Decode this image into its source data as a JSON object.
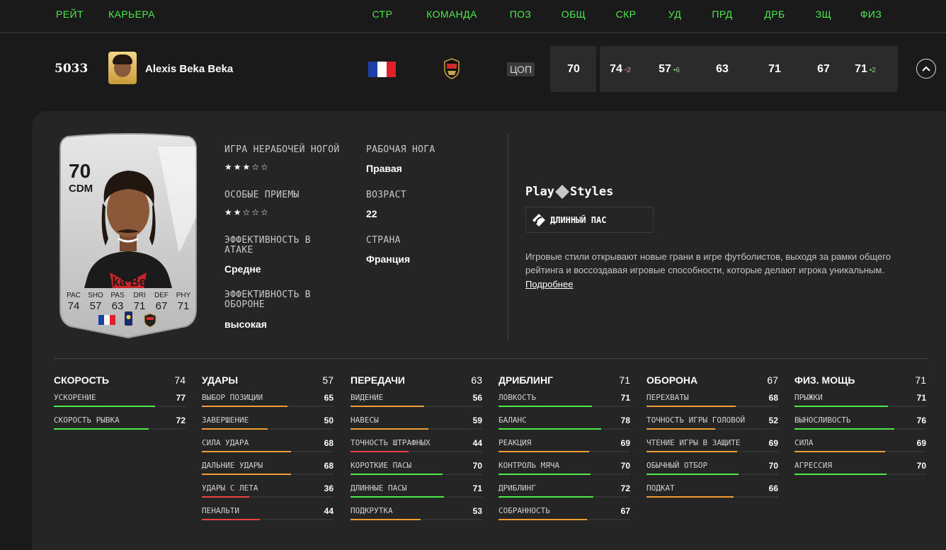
{
  "header": {
    "cols": [
      "РЕЙТ",
      "КАРЬЕРА",
      "СТР",
      "КОМАНДА",
      "ПОЗ",
      "ОБЩ",
      "СКР",
      "УД",
      "ПРД",
      "ДРБ",
      "ЗЩ",
      "ФИЗ"
    ]
  },
  "player": {
    "rank": "5033",
    "name": "Alexis Beka Beka",
    "position": "ЦОП",
    "overall": "70",
    "stats": [
      {
        "v": "74",
        "delta": "2",
        "dir": "down"
      },
      {
        "v": "57",
        "delta": "6",
        "dir": "up"
      },
      {
        "v": "63",
        "delta": "",
        "dir": ""
      },
      {
        "v": "71",
        "delta": "",
        "dir": ""
      },
      {
        "v": "67",
        "delta": "",
        "dir": ""
      },
      {
        "v": "71",
        "delta": "2",
        "dir": "up"
      }
    ]
  },
  "card": {
    "rating": "70",
    "pos": "CDM",
    "name": "Beka Beka",
    "stats": [
      {
        "l": "PAC",
        "v": "74"
      },
      {
        "l": "SHO",
        "v": "57"
      },
      {
        "l": "PAS",
        "v": "63"
      },
      {
        "l": "DRI",
        "v": "71"
      },
      {
        "l": "DEF",
        "v": "67"
      },
      {
        "l": "PHY",
        "v": "71"
      }
    ]
  },
  "details": {
    "weakfoot_label": "ИГРА НЕРАБОЧЕЙ НОГОЙ",
    "weakfoot_stars": 3,
    "skills_label": "ОСОБЫЕ ПРИЕМЫ",
    "skills_stars": 2,
    "attwr_label": "ЭФФЕКТИВНОСТЬ В АТАКЕ",
    "attwr_value": "Средне",
    "defwr_label": "ЭФФЕКТИВНОСТЬ В ОБОРОНЕ",
    "defwr_value": "высокая",
    "foot_label": "РАБОЧАЯ НОГА",
    "foot_value": "Правая",
    "age_label": "ВОЗРАСТ",
    "age_value": "22",
    "country_label": "СТРАНА",
    "country_value": "Франция"
  },
  "playstyles": {
    "title_a": "Play",
    "title_b": "Styles",
    "chip": "ДЛИННЫЙ ПАС",
    "desc": "Игровые стили открывают новые грани в игре футболистов, выходя за рамки общего рейтинга и воссоздавая игровые способности, которые делают игрока уникальным.",
    "link": "Подробнее"
  },
  "colors": {
    "green": "#4ee94e",
    "orange": "#f0a035",
    "red": "#e84444",
    "accent_green": "#4ee94e"
  },
  "groups": [
    {
      "name": "СКОРОСТЬ",
      "value": "74",
      "items": [
        {
          "n": "УСКОРЕНИЕ",
          "v": "77"
        },
        {
          "n": "СКОРОСТЬ РЫВКА",
          "v": "72"
        }
      ]
    },
    {
      "name": "УДАРЫ",
      "value": "57",
      "items": [
        {
          "n": "ВЫБОР ПОЗИЦИИ",
          "v": "65"
        },
        {
          "n": "ЗАВЕРШЕНИЕ",
          "v": "50"
        },
        {
          "n": "СИЛА УДАРА",
          "v": "68"
        },
        {
          "n": "ДАЛЬНИЕ УДАРЫ",
          "v": "68"
        },
        {
          "n": "УДАРЫ С ЛЕТА",
          "v": "36"
        },
        {
          "n": "ПЕНАЛЬТИ",
          "v": "44"
        }
      ]
    },
    {
      "name": "ПЕРЕДАЧИ",
      "value": "63",
      "items": [
        {
          "n": "ВИДЕНИЕ",
          "v": "56"
        },
        {
          "n": "НАВЕСЫ",
          "v": "59"
        },
        {
          "n": "ТОЧНОСТЬ ШТРАФНЫХ",
          "v": "44"
        },
        {
          "n": "КОРОТКИЕ ПАСЫ",
          "v": "70"
        },
        {
          "n": "ДЛИННЫЕ ПАСЫ",
          "v": "71"
        },
        {
          "n": "ПОДКРУТКА",
          "v": "53"
        }
      ]
    },
    {
      "name": "ДРИБЛИНГ",
      "value": "71",
      "items": [
        {
          "n": "ЛОВКОСТЬ",
          "v": "71"
        },
        {
          "n": "БАЛАНС",
          "v": "78"
        },
        {
          "n": "РЕАКЦИЯ",
          "v": "69"
        },
        {
          "n": "КОНТРОЛЬ МЯЧА",
          "v": "70"
        },
        {
          "n": "ДРИБЛИНГ",
          "v": "72"
        },
        {
          "n": "СОБРАННОСТЬ",
          "v": "67"
        }
      ]
    },
    {
      "name": "ОБОРОНА",
      "value": "67",
      "items": [
        {
          "n": "ПЕРЕХВАТЫ",
          "v": "68"
        },
        {
          "n": "ТОЧНОСТЬ ИГРЫ ГОЛОВОЙ",
          "v": "52"
        },
        {
          "n": "ЧТЕНИЕ ИГРЫ В ЗАЩИТЕ",
          "v": "69"
        },
        {
          "n": "ОБЫЧНЫЙ ОТБОР",
          "v": "70"
        },
        {
          "n": "ПОДКАТ",
          "v": "66"
        }
      ]
    },
    {
      "name": "ФИЗ. МОЩЬ",
      "value": "71",
      "items": [
        {
          "n": "ПРЫЖКИ",
          "v": "71"
        },
        {
          "n": "ВЫНОСЛИВОСТЬ",
          "v": "76"
        },
        {
          "n": "СИЛА",
          "v": "69"
        },
        {
          "n": "АГРЕССИЯ",
          "v": "70"
        }
      ]
    }
  ]
}
